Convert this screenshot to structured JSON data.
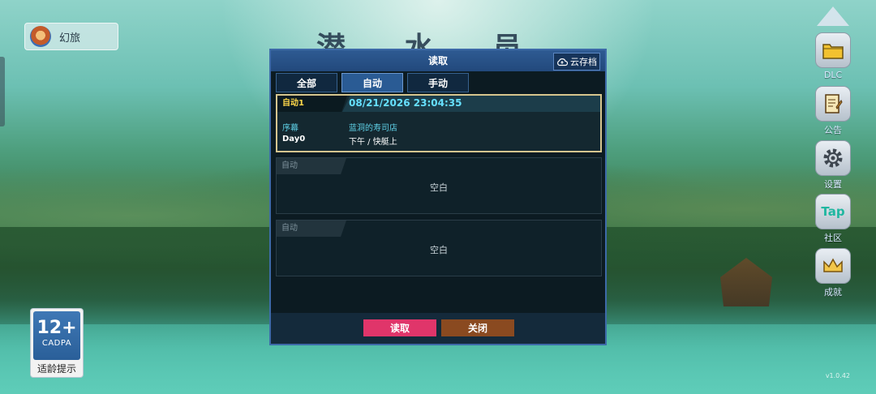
{
  "game_title": "潜 水 员",
  "user": {
    "name": "幻旅"
  },
  "age_badge": {
    "rating": "12+",
    "org": "CADPA",
    "label": "适龄提示"
  },
  "sidebar": [
    {
      "icon": "folder-icon",
      "label": "DLC"
    },
    {
      "icon": "notice-icon",
      "label": "公告"
    },
    {
      "icon": "gear-icon",
      "label": "设置"
    },
    {
      "icon": "tap-icon",
      "label": "社区",
      "icon_text": "Tap"
    },
    {
      "icon": "crown-icon",
      "label": "成就"
    }
  ],
  "dialog": {
    "title": "读取",
    "cloud_button": "云存档",
    "tabs": [
      "全部",
      "自动",
      "手动"
    ],
    "active_tab": "自动",
    "slots": [
      {
        "tag": "自动1",
        "time": "08/21/2026 23:04:35",
        "chapter": "序幕",
        "location": "蓝洞的寿司店",
        "day": "Day0",
        "period": "下午 / 快艇上"
      },
      {
        "tag": "自动",
        "empty_label": "空白"
      },
      {
        "tag": "自动",
        "empty_label": "空白"
      }
    ],
    "load_button": "读取",
    "close_button": "关闭"
  },
  "version": "v1.0.42",
  "colors": {
    "accent_load": "#e0356a",
    "accent_close": "#8a4a20",
    "dialog_border": "#3d6aa8",
    "time_text": "#66e0ff"
  }
}
